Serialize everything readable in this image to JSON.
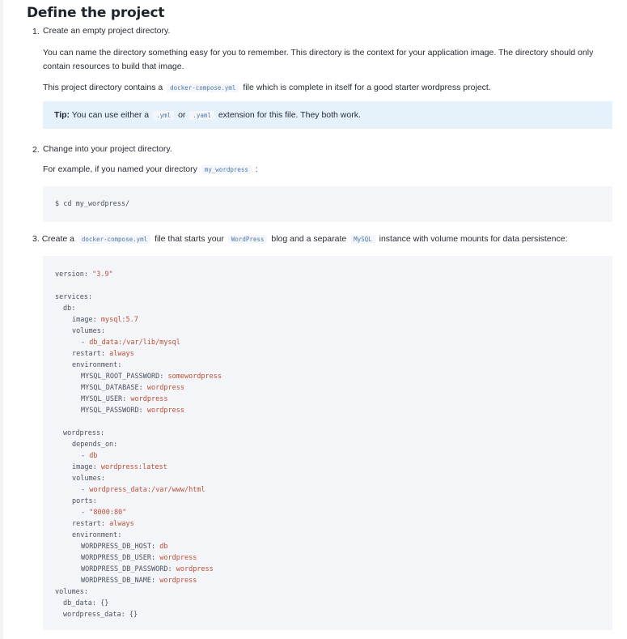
{
  "heading": "Define the project",
  "steps": [
    {
      "number": "1.",
      "title": "Create an empty project directory.",
      "para1": "You can name the directory something easy for you to remember. This directory is the context for your application image. The directory should only contain resources to build that image.",
      "para2_before": "This project directory contains a",
      "para2_code": "docker-compose.yml",
      "para2_after": "file which is complete in itself for a good starter wordpress project.",
      "tip_label": "Tip:",
      "tip_before": "You can use either a",
      "tip_code1": ".yml",
      "tip_or": "or",
      "tip_code2": ".yaml",
      "tip_after": "extension for this file. They both work."
    },
    {
      "number": "2.",
      "title": "Change into your project directory.",
      "para_before": "For example, if you named your directory",
      "para_code": "my_wordpress",
      "para_after": ":",
      "command": "$ cd my_wordpress/"
    },
    {
      "number": "3.",
      "t_before": "Create a",
      "t_code1": "docker-compose.yml",
      "t_mid1": "file that starts your",
      "t_code2": "WordPress",
      "t_mid2": "blog and a separate",
      "t_code3": "MySQL",
      "t_after": "instance with volume mounts for data persistence:"
    }
  ],
  "yaml": {
    "version_key": "version:",
    "version_val": "\"3.9\"",
    "services": "services:",
    "db": "db:",
    "db_image_key": "image:",
    "db_image_val": "mysql:5.7",
    "db_volumes": "volumes:",
    "db_vol_dash": "- ",
    "db_vol_val": "db_data:/var/lib/mysql",
    "db_restart_key": "restart:",
    "db_restart_val": "always",
    "db_env": "environment:",
    "db_env1_key": "MYSQL_ROOT_PASSWORD:",
    "db_env1_val": "somewordpress",
    "db_env2_key": "MYSQL_DATABASE:",
    "db_env2_val": "wordpress",
    "db_env3_key": "MYSQL_USER:",
    "db_env3_val": "wordpress",
    "db_env4_key": "MYSQL_PASSWORD:",
    "db_env4_val": "wordpress",
    "wp": "wordpress:",
    "wp_depends": "depends_on:",
    "wp_dep_dash": "- ",
    "wp_dep_val": "db",
    "wp_image_key": "image:",
    "wp_image_val": "wordpress:latest",
    "wp_volumes": "volumes:",
    "wp_vol_dash": "- ",
    "wp_vol_val": "wordpress_data:/var/www/html",
    "wp_ports": "ports:",
    "wp_port_dash": "- ",
    "wp_port_val": "\"8000:80\"",
    "wp_restart_key": "restart:",
    "wp_restart_val": "always",
    "wp_env": "environment:",
    "wp_env1_key": "WORDPRESS_DB_HOST:",
    "wp_env1_val": "db",
    "wp_env2_key": "WORDPRESS_DB_USER:",
    "wp_env2_val": "wordpress",
    "wp_env3_key": "WORDPRESS_DB_PASSWORD:",
    "wp_env3_val": "wordpress",
    "wp_env4_key": "WORDPRESS_DB_NAME:",
    "wp_env4_val": "wordpress",
    "volumes": "volumes:",
    "vol1_key": "db_data:",
    "vol1_val": "{}",
    "vol2_key": "wordpress_data:",
    "vol2_val": "{}"
  }
}
